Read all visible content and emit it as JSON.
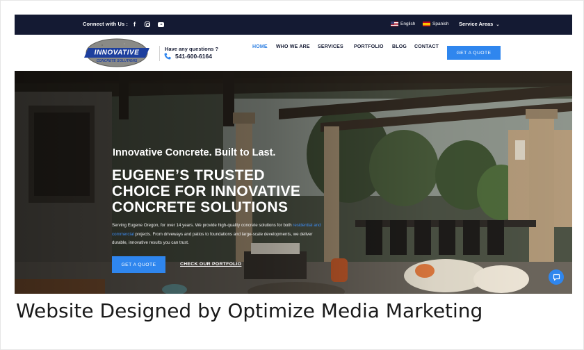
{
  "topbar": {
    "connect_label": "Connect with Us :",
    "social_icons": [
      "facebook-icon",
      "instagram-icon",
      "youtube-icon"
    ],
    "languages": [
      {
        "label": "English",
        "flag": "us-flag-icon"
      },
      {
        "label": "Spanish",
        "flag": "spain-flag-icon"
      }
    ],
    "service_areas_label": "Service Areas"
  },
  "navbar": {
    "logo_text_top": "INNOVATIVE",
    "logo_text_bottom": "CONCRETE SOLUTIONS",
    "questions_label": "Have any questions ?",
    "phone": "541-600-6164",
    "menu": [
      {
        "label": "HOME",
        "active": true
      },
      {
        "label": "WHO WE ARE",
        "active": false
      },
      {
        "label": "SERVICES",
        "active": false
      },
      {
        "label": "PORTFOLIO",
        "active": false
      },
      {
        "label": "BLOG",
        "active": false
      },
      {
        "label": "CONTACT",
        "active": false
      }
    ],
    "cta_label": "GET A QUOTE"
  },
  "hero": {
    "tagline": "Innovative Concrete. Built to Last.",
    "title_lines": [
      "EUGENE’S TRUSTED",
      "CHOICE FOR INNOVATIVE",
      "CONCRETE SOLUTIONS"
    ],
    "desc_part1": "Serving Eugene Oregon, for over 14 years. We provide high-quality concrete solutions for both",
    "desc_link": "residential and commercial",
    "desc_part2": " projects. From driveways and patios to foundations and large-scale developments, we deliver durable, innovative results you can trust.",
    "primary_button": "GET A QUOTE",
    "secondary_link": "CHECK OUR PORTFOLIO"
  },
  "caption": "Website Designed by Optimize Media Marketing",
  "colors": {
    "topbar_bg": "#141a33",
    "accent_blue": "#2f86ee",
    "nav_text": "#141a33",
    "active_nav": "#2a7de1"
  }
}
